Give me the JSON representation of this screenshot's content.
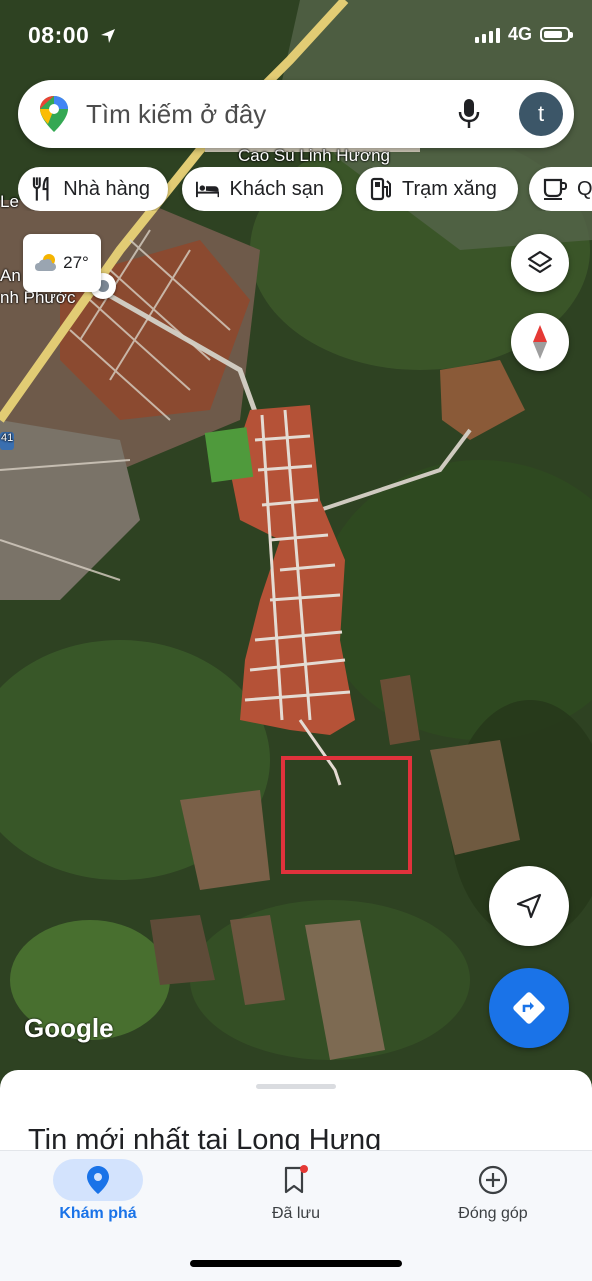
{
  "status_bar": {
    "time": "08:00",
    "network": "4G"
  },
  "search": {
    "placeholder": "Tìm kiếm ở đây",
    "avatar_letter": "t"
  },
  "chips": [
    {
      "label": "Nhà hàng",
      "icon": "restaurant-icon"
    },
    {
      "label": "Khách sạn",
      "icon": "hotel-icon"
    },
    {
      "label": "Trạm xăng",
      "icon": "gas-station-icon"
    },
    {
      "label": "Q",
      "icon": "coffee-icon"
    }
  ],
  "weather": {
    "temperature": "27°",
    "icon": "partly-cloudy-icon"
  },
  "map": {
    "labels": {
      "place_top": "Cao Su Linh Hương",
      "place_left_1": "An",
      "place_left_2": "nh Phước",
      "edge_le": "Le",
      "road_badge": "41"
    },
    "attribution": "Google",
    "highlight_color": "#e0323c"
  },
  "sheet": {
    "title": "Tin mới nhất tại Long Hưng"
  },
  "bottom_nav": [
    {
      "label": "Khám phá",
      "icon": "explore-pin-icon",
      "active": true
    },
    {
      "label": "Đã lưu",
      "icon": "saved-bookmark-icon",
      "active": false
    },
    {
      "label": "Đóng góp",
      "icon": "contribute-plus-icon",
      "active": false
    }
  ],
  "colors": {
    "accent": "#1a73e8",
    "active_nav_bg": "#d3e3fd"
  }
}
